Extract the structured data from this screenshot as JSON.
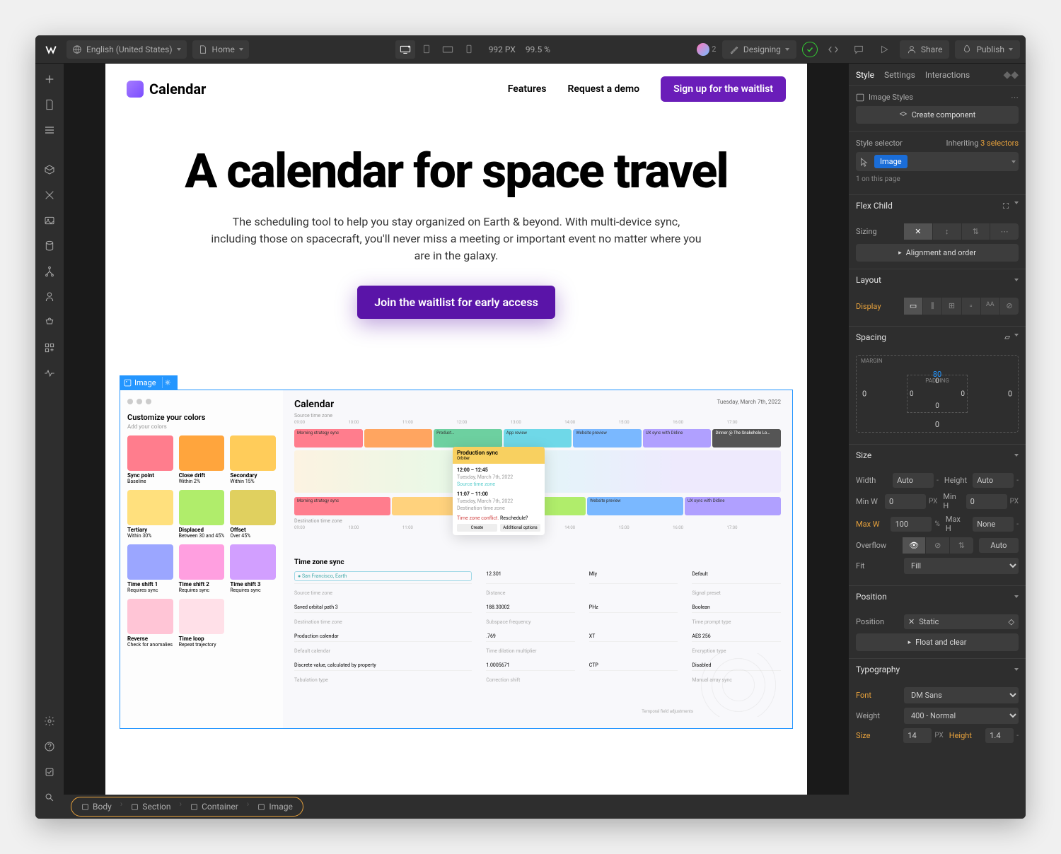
{
  "topbar": {
    "locale": "English (United States)",
    "page": "Home",
    "width": "992 PX",
    "zoom": "99.5 %",
    "collab_count": "2",
    "mode": "Designing",
    "share": "Share",
    "publish": "Publish"
  },
  "canvas_page": {
    "logo_text": "Calendar",
    "nav_features": "Features",
    "nav_demo": "Request a demo",
    "nav_cta": "Sign up for the waitlist",
    "hero_title": "A calendar for space travel",
    "hero_body": "The scheduling tool to help you stay organized on Earth & beyond. With multi-device sync, including those on spacecraft, you'll never miss a meeting or important event no matter where you are in the galaxy.",
    "hero_cta": "Join the waitlist for early access"
  },
  "selected_element": {
    "label": "Image"
  },
  "mock": {
    "customize_title": "Customize your colors",
    "customize_sub": "Add your colors",
    "swatches": [
      {
        "color": "#ff7d8d",
        "name": "Sync point",
        "meta": "Baseline"
      },
      {
        "color": "#ffa53d",
        "name": "Close drift",
        "meta": "Within 2%"
      },
      {
        "color": "#ffcc5a",
        "name": "Secondary",
        "meta": "Within 15%"
      },
      {
        "color": "#ffe07d",
        "name": "Tertiary",
        "meta": "Within 30%"
      },
      {
        "color": "#b0ed6b",
        "name": "Displaced",
        "meta": "Between 30 and 45%"
      },
      {
        "color": "#e0d05f",
        "name": "Offset",
        "meta": "Over 45%"
      },
      {
        "color": "#9ba6ff",
        "name": "Time shift 1",
        "meta": "Requires sync"
      },
      {
        "color": "#ff9fe0",
        "name": "Time shift 2",
        "meta": "Requires sync"
      },
      {
        "color": "#d29fff",
        "name": "Time shift 3",
        "meta": "Requires sync"
      },
      {
        "color": "#ffc5d6",
        "name": "Reverse",
        "meta": "Check for anomalies"
      },
      {
        "color": "#ffe0e8",
        "name": "Time loop",
        "meta": "Repeat trajectory"
      }
    ],
    "cal_title": "Calendar",
    "date": "Tuesday, March 7th, 2022",
    "src_tz": "Source time zone",
    "dst_tz": "Destination time zone",
    "times": [
      "09:00",
      "10:00",
      "11:00",
      "12:00",
      "13:00",
      "14:00",
      "15:00",
      "16:00",
      "17:00"
    ],
    "events_a": [
      {
        "c": "#ff7d8d",
        "t": "Morning strategy sync"
      },
      {
        "c": "#ffa560",
        "t": ""
      },
      {
        "c": "#6dd0a0",
        "t": "Product…"
      },
      {
        "c": "#6fd8e8",
        "t": "App review"
      },
      {
        "c": "#7ab8ff",
        "t": "Website preview"
      },
      {
        "c": "#b0a0ff",
        "t": "UX sync with Didine"
      },
      {
        "c": "#555",
        "t": "Dinner @ The Snakehole Lo…",
        "fg": "#fff"
      }
    ],
    "events_b": [
      {
        "c": "#ff7d8d",
        "t": "Morning strategy sync"
      },
      {
        "c": "#ffd27d",
        "t": ""
      },
      {
        "c": "#b0ed6b",
        "t": ""
      },
      {
        "c": "#7ab8ff",
        "t": "Website preview"
      },
      {
        "c": "#b0a0ff",
        "t": "UX sync with Didine"
      }
    ],
    "popup": {
      "title": "Production sync",
      "sub": "Orbiter",
      "time1": "12:00 – 12:45",
      "date1": "Tuesday, March 7th, 2022",
      "src": "Source time zone",
      "time2": "11:07 – 11:00",
      "date2": "Tuesday, March 7th, 2022",
      "dst": "Destination time zone",
      "conflict": "Time zone conflict.",
      "resched": "Reschedule?",
      "btn1": "Create",
      "btn2": "Additional options"
    },
    "form": {
      "title": "Time zone sync",
      "rows": [
        [
          "San Francisco, Earth",
          "12.301",
          "MIy",
          "Default"
        ],
        [
          "Source time zone",
          "Distance",
          "",
          "Signal preset"
        ],
        [
          "Saved orbital path 3",
          "188.30002",
          "PHz",
          "Boolean"
        ],
        [
          "Destination time zone",
          "Subspace frequency",
          "",
          "Time prompt type"
        ],
        [
          "Production calendar",
          ".769",
          "XT",
          "AES 256"
        ],
        [
          "Default calendar",
          "Time dilation multiplier",
          "",
          "Encryption type"
        ],
        [
          "Discrete value, calculated by property",
          "1.0005671",
          "CTP",
          "Disabled"
        ],
        [
          "Tabulation type",
          "Correction shift",
          "",
          "Manual array sync"
        ]
      ],
      "radar_side": "Temporal field adjustments"
    }
  },
  "breadcrumb": [
    {
      "label": "Body",
      "icon": "box"
    },
    {
      "label": "Section",
      "icon": "sec"
    },
    {
      "label": "Container",
      "icon": "box"
    },
    {
      "label": "Image",
      "icon": "img"
    }
  ],
  "style_panel": {
    "tabs": [
      "Style",
      "Settings",
      "Interactions"
    ],
    "element_type": "Image Styles",
    "create_component": "Create component",
    "selector_label": "Style selector",
    "inheriting": "Inheriting",
    "inheriting_count": "3 selectors",
    "selector_tag": "Image",
    "on_page": "1 on this page",
    "flex_child": "Flex Child",
    "sizing": "Sizing",
    "align_order": "Alignment and order",
    "layout": "Layout",
    "display": "Display",
    "spacing_title": "Spacing",
    "margin_label": "MARGIN",
    "padding_label": "PADDING",
    "margin_top": "80",
    "zeros": "0",
    "size": "Size",
    "width": "Width",
    "width_v": "Auto",
    "height": "Height",
    "height_v": "Auto",
    "minw": "Min W",
    "minw_v": "0",
    "px": "PX",
    "minh": "Min H",
    "minh_v": "0",
    "maxw": "Max W",
    "maxw_v": "100",
    "pct": "%",
    "maxh": "Max H",
    "maxh_v": "None",
    "overflow": "Overflow",
    "overflow_auto": "Auto",
    "fit": "Fit",
    "fit_v": "Fill",
    "position": "Position",
    "position_v": "Static",
    "float_clear": "Float and clear",
    "typography": "Typography",
    "font": "Font",
    "font_v": "DM Sans",
    "weight": "Weight",
    "weight_v": "400 - Normal",
    "fsize": "Size",
    "fsize_v": "14",
    "lheight": "Height",
    "lheight_v": "1.4",
    "dash": "-"
  }
}
